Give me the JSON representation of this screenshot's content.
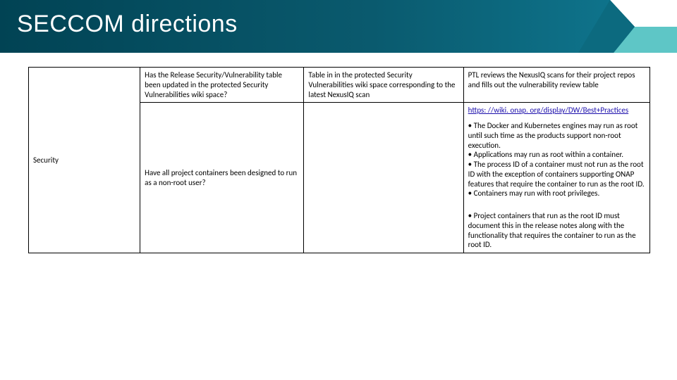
{
  "header": {
    "title": "SECCOM directions"
  },
  "table": {
    "rowLabel": "Security",
    "rows": [
      {
        "question": "Has the Release Security/Vulnerability table been updated in the  protected Security Vulnerabilities wiki space?",
        "explanation": "Table in in the protected Security Vulnerabilities wiki space corresponding to the latest NexusIQ scan",
        "notes": {
          "blocks": [
            {
              "type": "text",
              "text": "PTL reviews the NexusIQ scans for their project repos and fills out   the vulnerability review table"
            }
          ]
        }
      },
      {
        "question": "Have all project containers been designed to run as a non-root user?",
        "explanation": "",
        "notes": {
          "blocks": [
            {
              "type": "link",
              "text": " https: //wiki. onap. org/display/DW/Best+Practices"
            },
            {
              "type": "bullet",
              "text": "• The Docker and Kubernetes engines may run as root until such time as the products support non-root execution."
            },
            {
              "type": "bullet",
              "text": "• Applications may run as root within a container."
            },
            {
              "type": "bullet",
              "text": "• The process ID of a container must not run as the root ID with the exception of containers supporting ONAP features that require the container to run as the root ID."
            },
            {
              "type": "bullet",
              "text": "• Containers may run with root privileges."
            },
            {
              "type": "spacer"
            },
            {
              "type": "bullet",
              "text": "• Project containers that run as the root ID must document this in the release notes along with the functionality that requires the container to run as the root ID."
            }
          ]
        }
      }
    ]
  }
}
